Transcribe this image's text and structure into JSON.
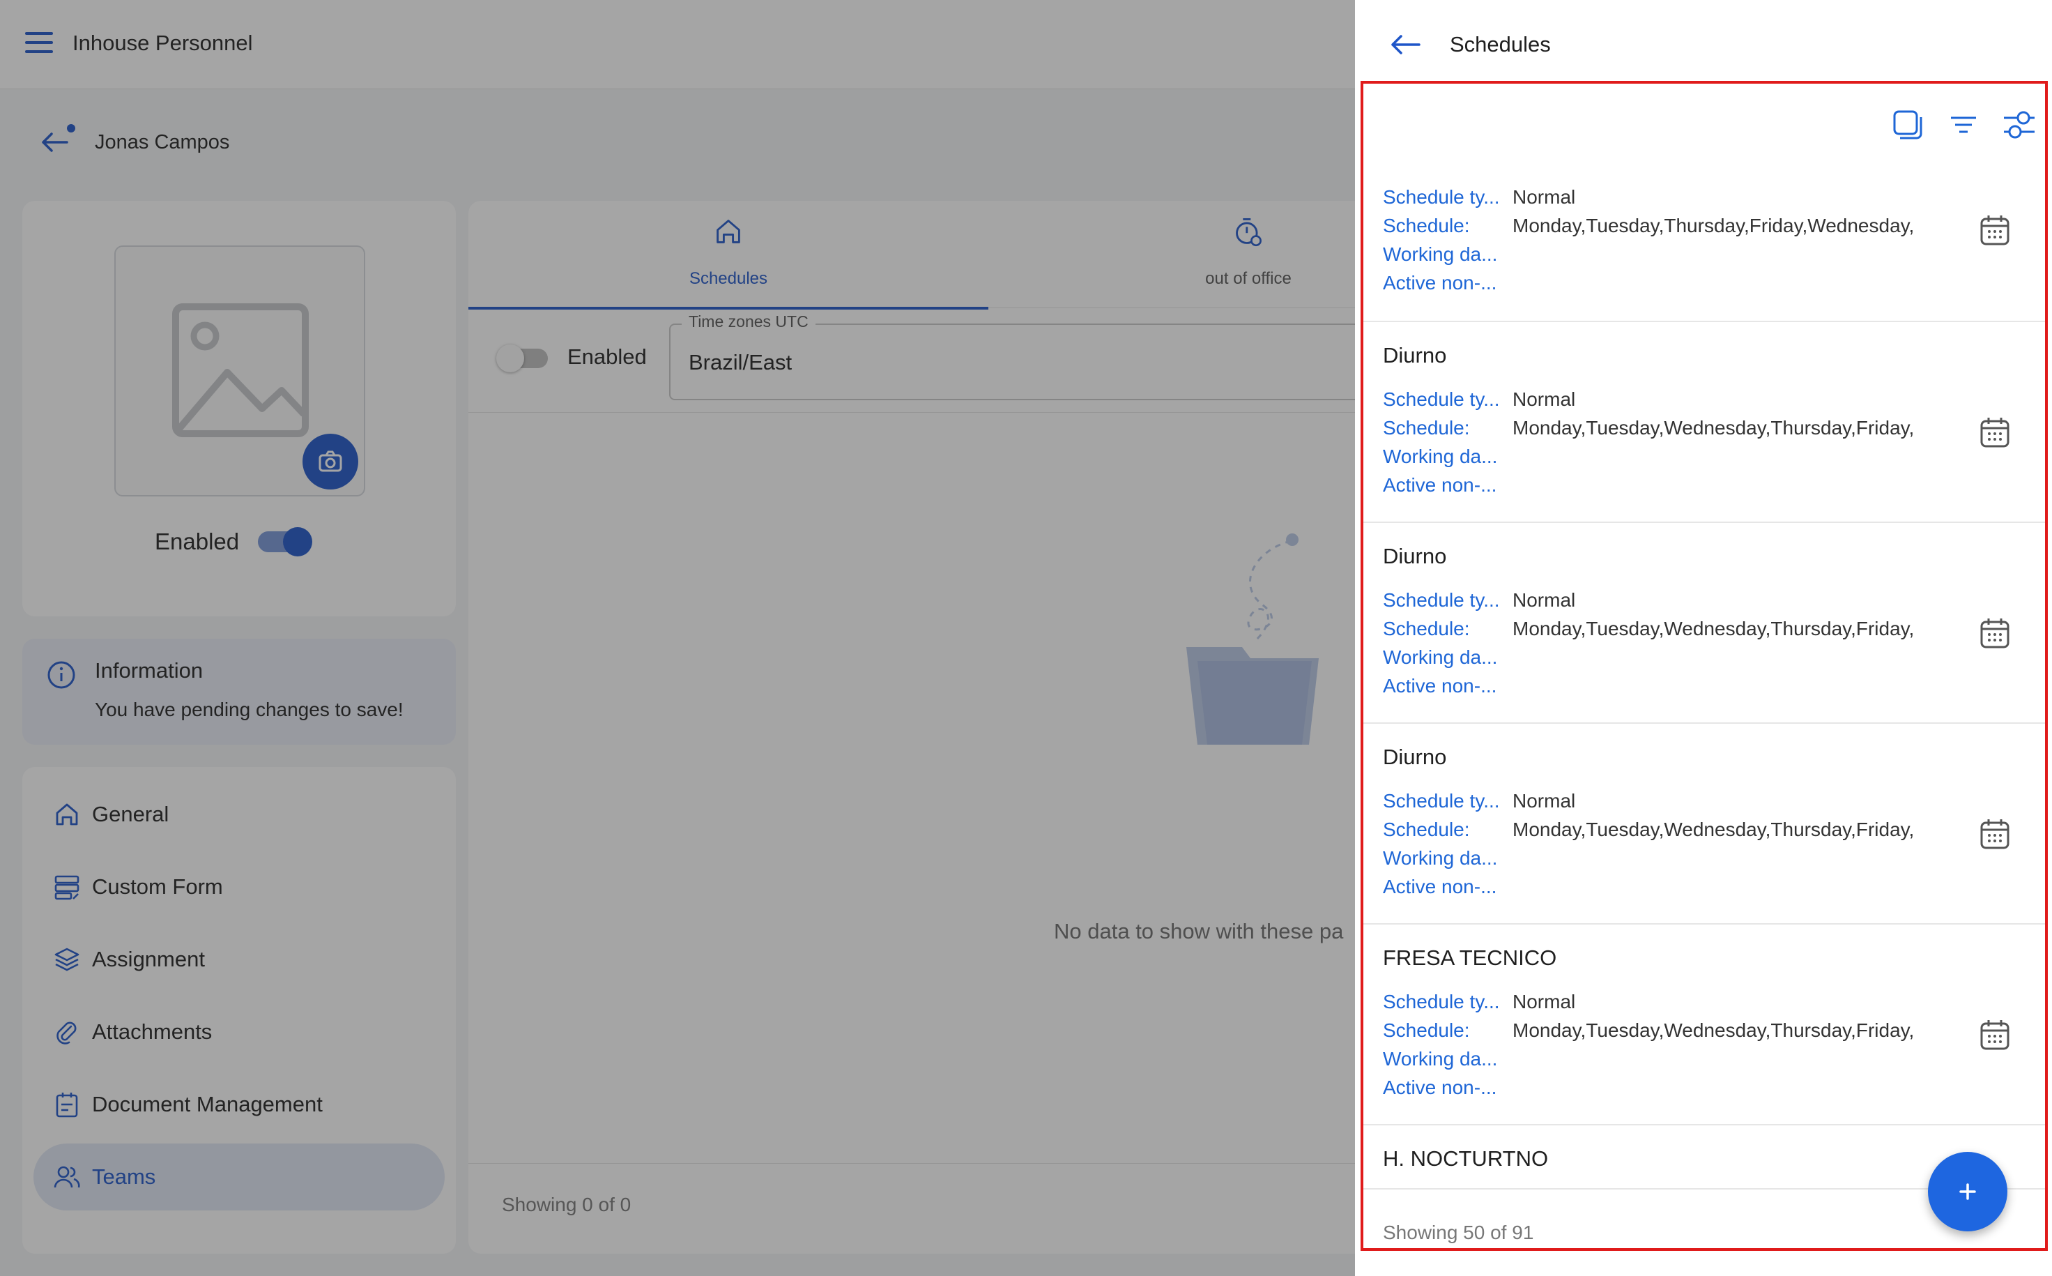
{
  "app": {
    "title": "Inhouse Personnel"
  },
  "person": {
    "name": "Jonas Campos"
  },
  "profile": {
    "enabled_label": "Enabled"
  },
  "info": {
    "title": "Information",
    "text": "You have pending changes to save!"
  },
  "nav": {
    "items": [
      {
        "label": "General",
        "icon": "home-icon"
      },
      {
        "label": "Custom Form",
        "icon": "form-icon"
      },
      {
        "label": "Assignment",
        "icon": "layers-icon"
      },
      {
        "label": "Attachments",
        "icon": "attachment-icon"
      },
      {
        "label": "Document Management",
        "icon": "document-icon"
      },
      {
        "label": "Teams",
        "icon": "teams-icon",
        "active": true
      }
    ]
  },
  "tabs": [
    {
      "label": "Schedules",
      "icon": "home-icon",
      "active": true
    },
    {
      "label": "out of office",
      "icon": "timer-icon"
    }
  ],
  "filters": {
    "enabled_label": "Enabled",
    "timezone_label": "Time zones UTC",
    "timezone_value": "Brazil/East"
  },
  "content": {
    "empty_text": "No data to show with these pa",
    "showing": "Showing 0 of 0"
  },
  "drawer": {
    "title": "Schedules",
    "labels": {
      "type": "Schedule ty...",
      "schedule": "Schedule:",
      "working": "Working da...",
      "active": "Active non-..."
    },
    "items": [
      {
        "name": "",
        "type": "Normal",
        "schedule": "Monday,Tuesday,Thursday,Friday,Wednesday,"
      },
      {
        "name": "Diurno",
        "type": "Normal",
        "schedule": "Monday,Tuesday,Wednesday,Thursday,Friday,"
      },
      {
        "name": "Diurno",
        "type": "Normal",
        "schedule": "Monday,Tuesday,Wednesday,Thursday,Friday,"
      },
      {
        "name": "Diurno",
        "type": "Normal",
        "schedule": "Monday,Tuesday,Wednesday,Thursday,Friday,"
      },
      {
        "name": "FRESA TECNICO",
        "type": "Normal",
        "schedule": "Monday,Tuesday,Wednesday,Thursday,Friday,"
      },
      {
        "name": "H. NOCTURTNO",
        "type": "",
        "schedule": ""
      }
    ],
    "showing": "Showing 50 of 91"
  },
  "colors": {
    "accent": "#1e55c8",
    "link": "#1e66d6",
    "highlight_border": "#e01b1b"
  }
}
